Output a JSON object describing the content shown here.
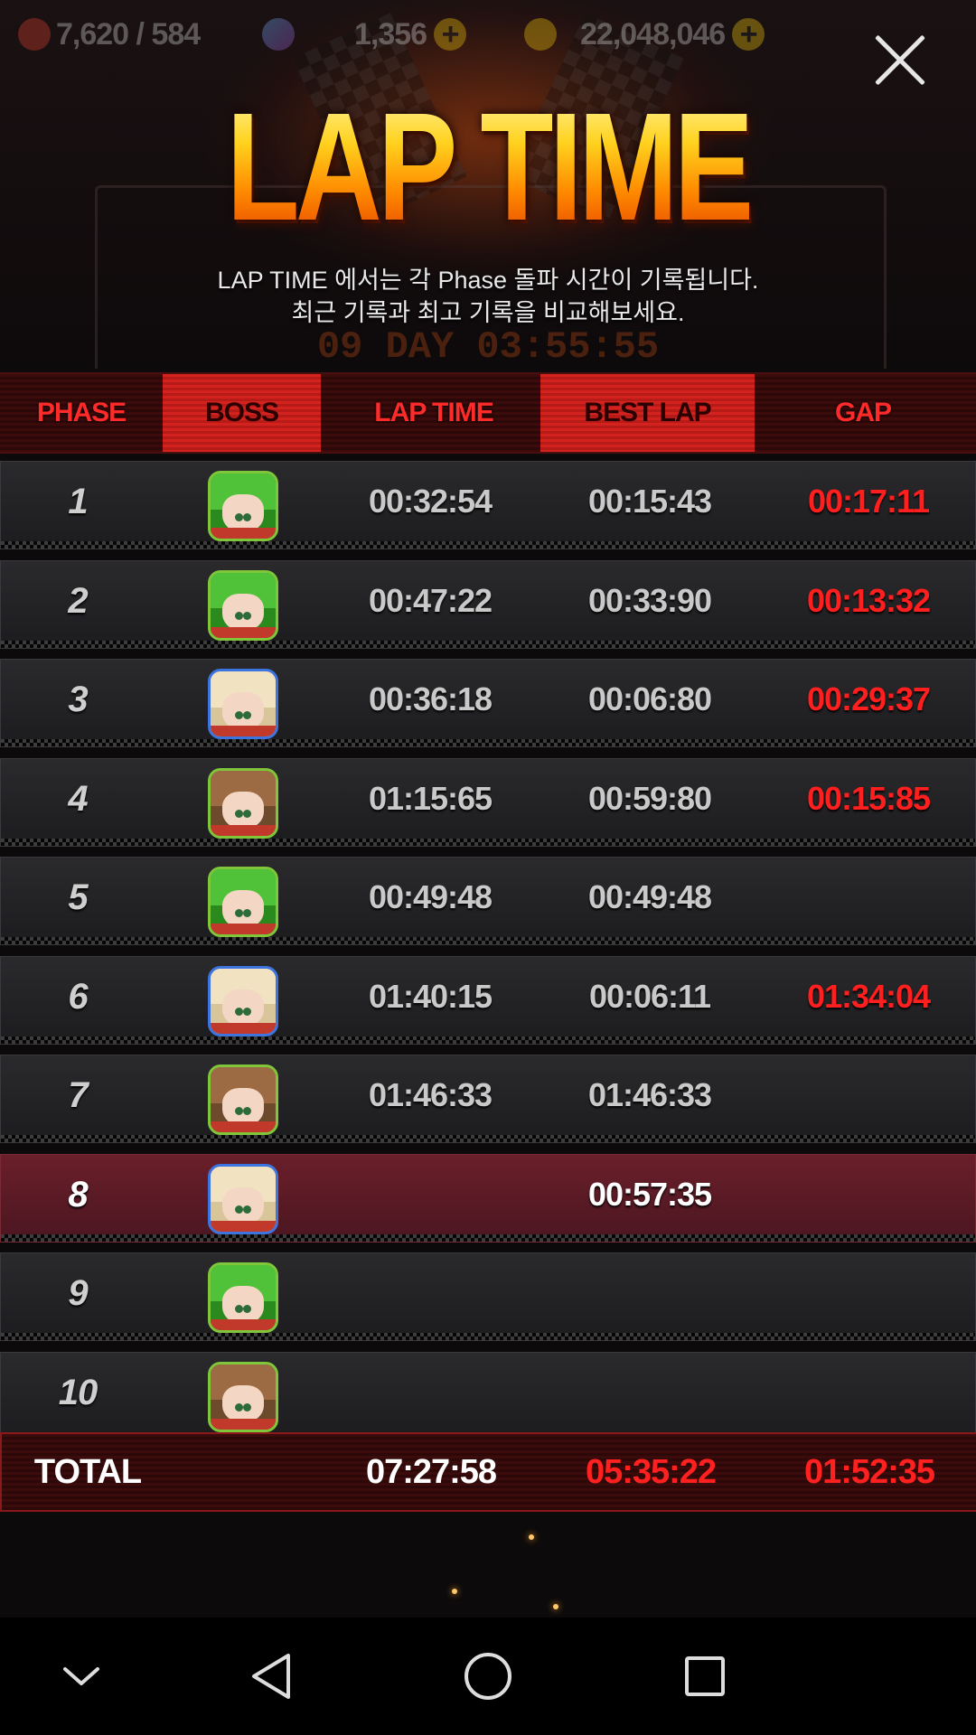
{
  "resources": {
    "stamina": "7,620 / 584",
    "gems": "1,356",
    "gold": "22,048,046"
  },
  "title": "LAP TIME",
  "description": [
    "LAP TIME 에서는 각 Phase 돌파 시간이 기록됩니다.",
    "최근 기록과 최고 기록을 비교해보세요."
  ],
  "timer": "09 DAY 03:55:55",
  "columns": {
    "phase": "PHASE",
    "boss": "BOSS",
    "lap_time": "LAP TIME",
    "best_lap": "BEST LAP",
    "gap": "GAP"
  },
  "rows": [
    {
      "phase": "1",
      "boss_icon": "green-haired-girl-avatar",
      "lap": "00:32:54",
      "best": "00:15:43",
      "gap": "00:17:11"
    },
    {
      "phase": "2",
      "boss_icon": "green-haired-girl-avatar",
      "lap": "00:47:22",
      "best": "00:33:90",
      "gap": "00:13:32"
    },
    {
      "phase": "3",
      "boss_icon": "blonde-girl-avatar",
      "lap": "00:36:18",
      "best": "00:06:80",
      "gap": "00:29:37"
    },
    {
      "phase": "4",
      "boss_icon": "brown-haired-girl-avatar",
      "lap": "01:15:65",
      "best": "00:59:80",
      "gap": "00:15:85"
    },
    {
      "phase": "5",
      "boss_icon": "green-haired-girl-avatar",
      "lap": "00:49:48",
      "best": "00:49:48",
      "gap": ""
    },
    {
      "phase": "6",
      "boss_icon": "blonde-girl-avatar",
      "lap": "01:40:15",
      "best": "00:06:11",
      "gap": "01:34:04"
    },
    {
      "phase": "7",
      "boss_icon": "brown-haired-girl-avatar",
      "lap": "01:46:33",
      "best": "01:46:33",
      "gap": ""
    },
    {
      "phase": "8",
      "boss_icon": "blonde-girl-avatar",
      "lap": "",
      "best": "00:57:35",
      "gap": "",
      "active": true
    },
    {
      "phase": "9",
      "boss_icon": "green-haired-girl-avatar",
      "lap": "",
      "best": "",
      "gap": ""
    },
    {
      "phase": "10",
      "boss_icon": "brown-haired-girl-avatar",
      "lap": "",
      "best": "",
      "gap": ""
    }
  ],
  "total": {
    "label": "TOTAL",
    "lap": "07:27:58",
    "best": "05:35:22",
    "gap": "01:52:35"
  },
  "colors": {
    "accent_red": "#ff1f1f",
    "header_red": "#d4231f",
    "logo_gold": "#ffb21e",
    "active_row": "#6a1f2a"
  },
  "nav_icons": [
    "chevron-down-icon",
    "back-icon",
    "home-icon",
    "recents-icon"
  ]
}
